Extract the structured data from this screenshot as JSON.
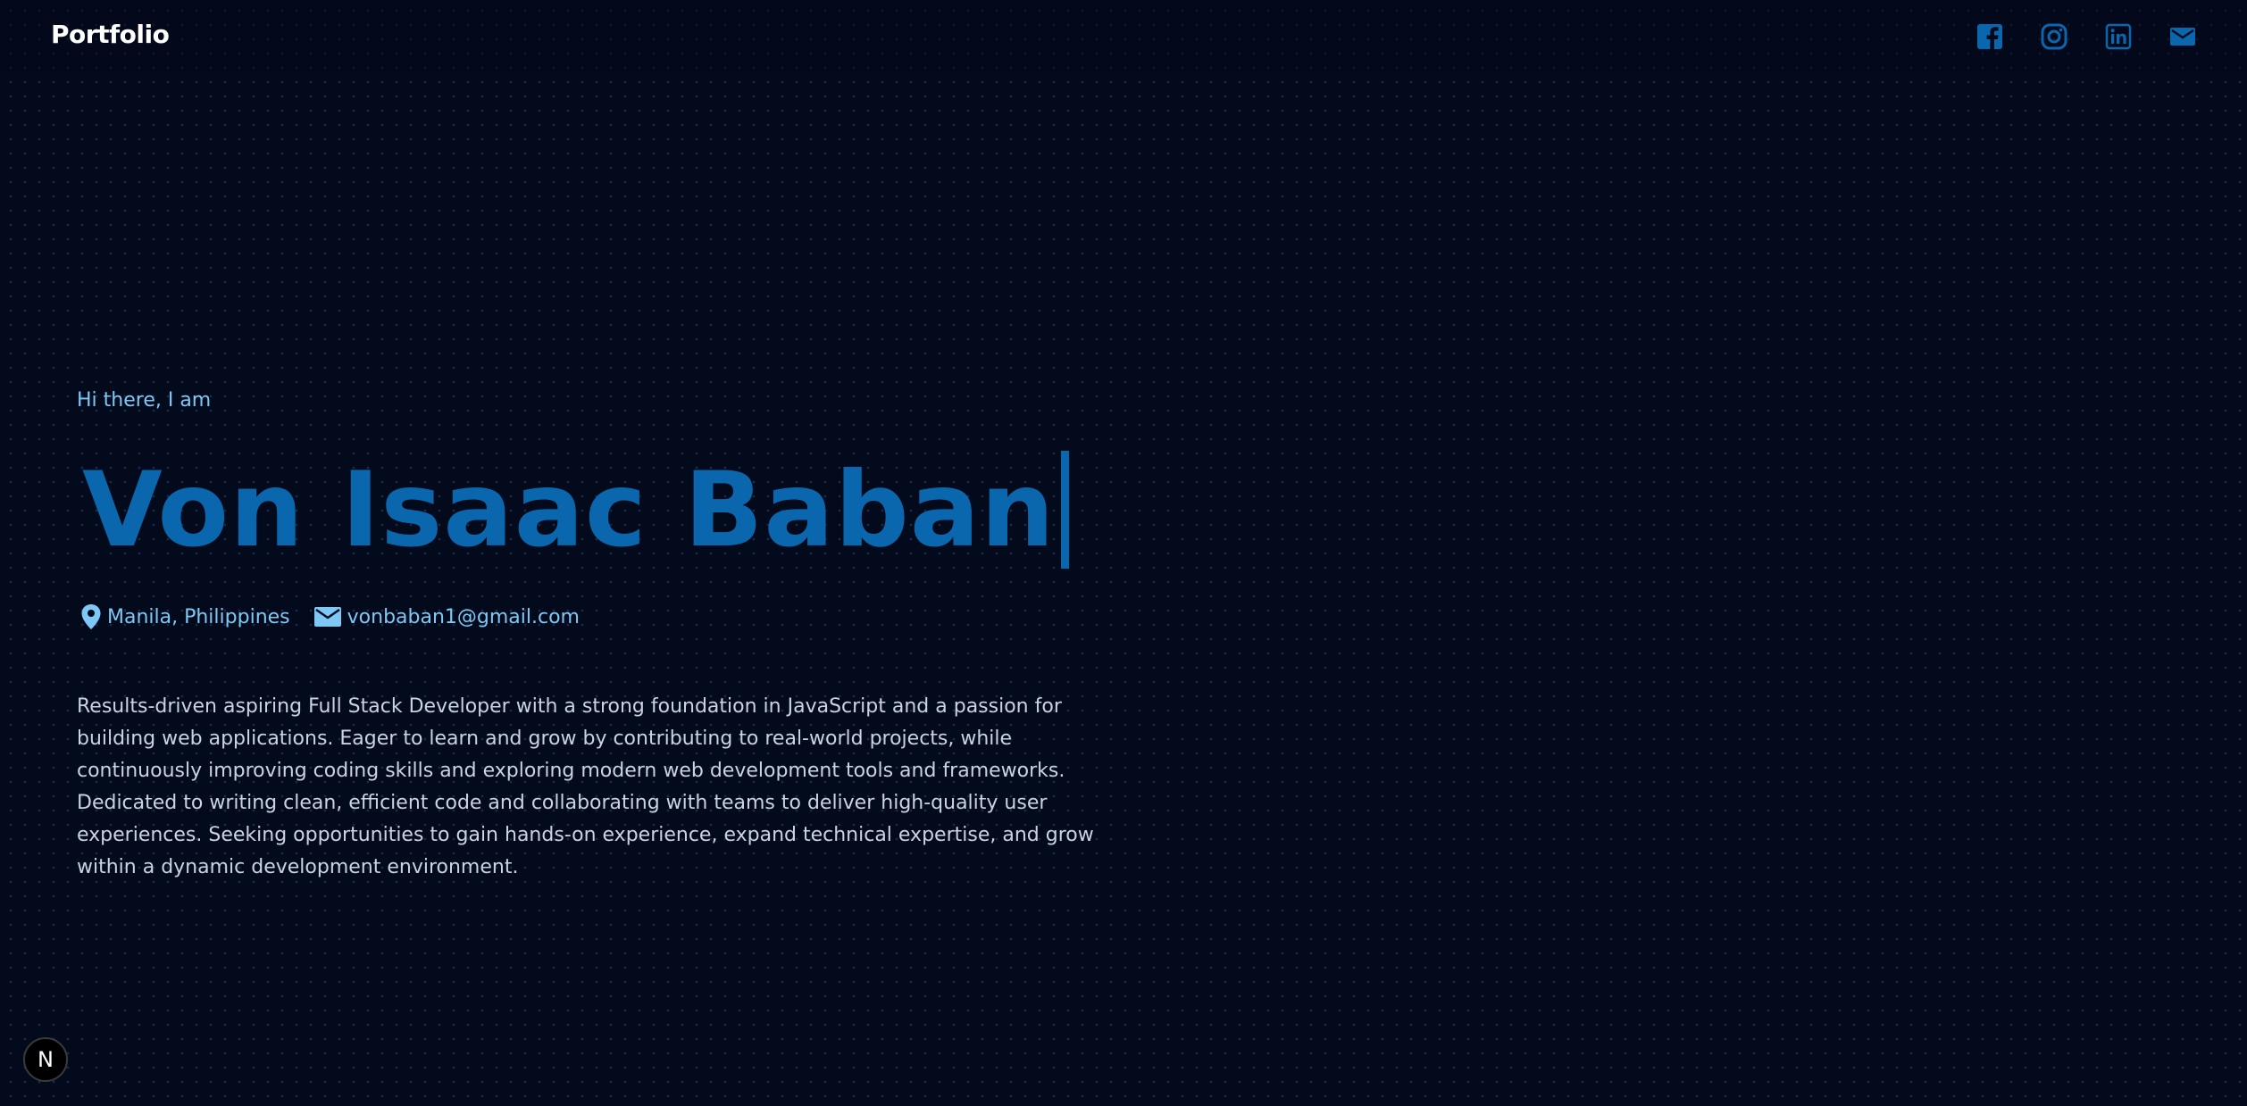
{
  "header": {
    "brand": "Portfolio",
    "socials": [
      {
        "icon": "facebook-icon"
      },
      {
        "icon": "instagram-icon"
      },
      {
        "icon": "linkedin-icon"
      },
      {
        "icon": "mail-icon"
      }
    ]
  },
  "hero": {
    "greeting": "Hi there, I am",
    "name": "Von Isaac Baban",
    "location": "Manila, Philippines",
    "location_icon": "location-pin-icon",
    "email": "vonbaban1@gmail.com",
    "email_icon": "mail-icon",
    "bio": "Results-driven aspiring Full Stack Developer with a strong foundation in JavaScript and a passion for building web applications. Eager to learn and grow by contributing to real-world projects, while continuously improving coding skills and exploring modern web development tools and frameworks. Dedicated to writing clean, efficient code and collaborating with teams to deliver high-quality user experiences. Seeking opportunities to gain hands-on experience, expand technical expertise, and grow within a dynamic development environment."
  },
  "dev_badge": {
    "letter": "N"
  },
  "colors": {
    "background": "#030a1c",
    "accent": "#0a67ad",
    "light_accent": "#7ec8f5",
    "text": "#c9d3e2"
  }
}
